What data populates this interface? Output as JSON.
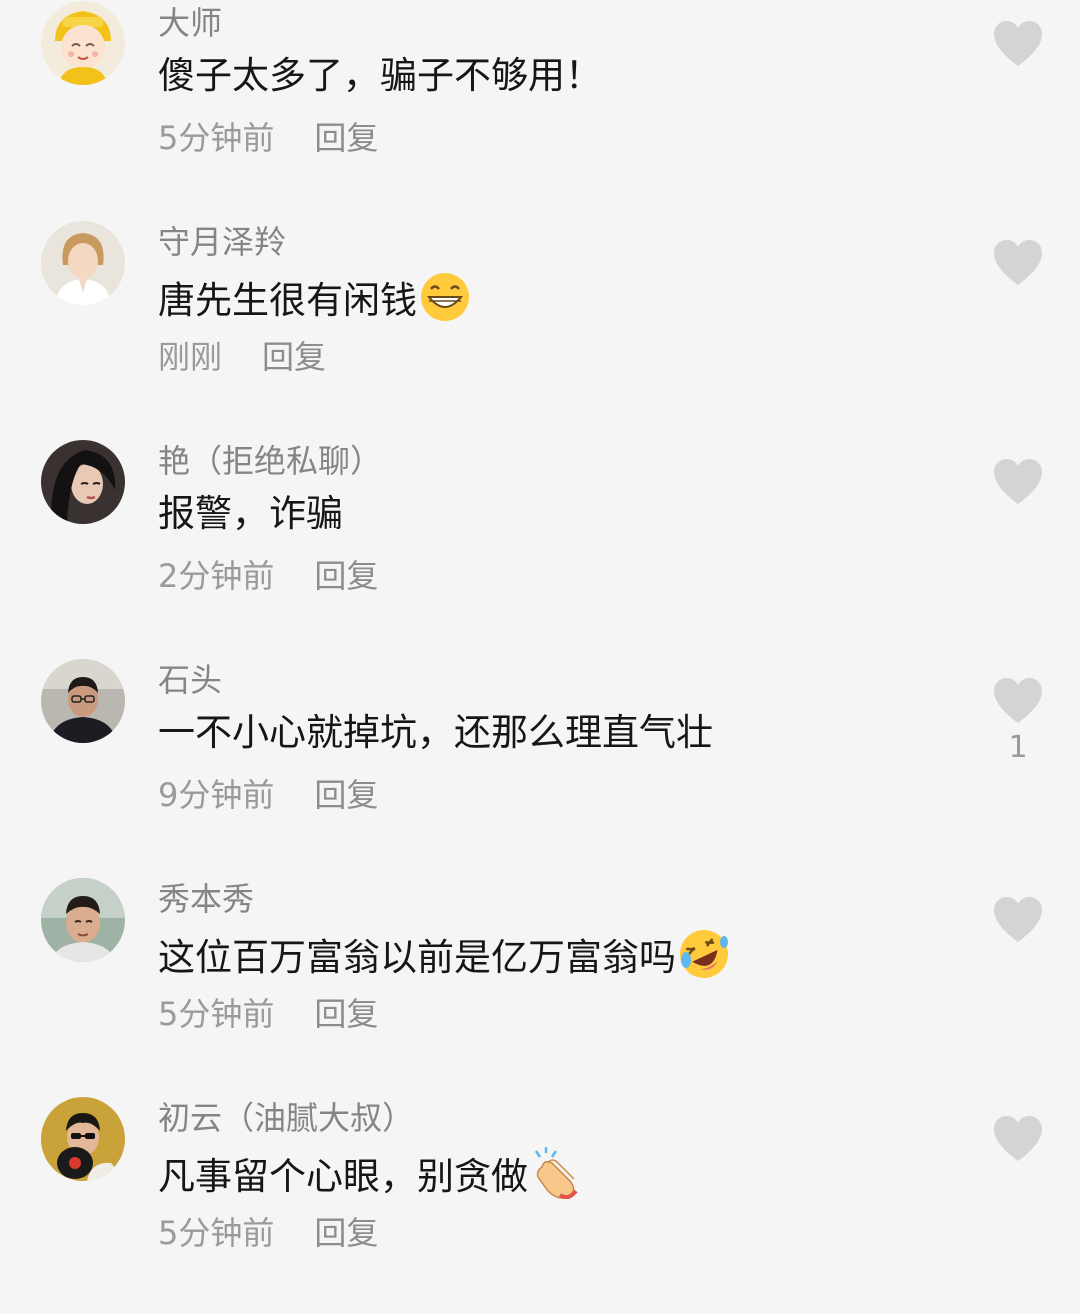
{
  "comments": [
    {
      "user": "大师",
      "text": "傻子太多了，骗子不够用！",
      "time": "5分钟前",
      "reply": "回复",
      "likes": "",
      "emoji": ""
    },
    {
      "user": "守月泽羚",
      "text": "唐先生很有闲钱",
      "time": "刚刚",
      "reply": "回复",
      "likes": "",
      "emoji": "grin-emoji"
    },
    {
      "user": "艳（拒绝私聊）",
      "text": "报警，诈骗",
      "time": "2分钟前",
      "reply": "回复",
      "likes": "",
      "emoji": ""
    },
    {
      "user": "石头",
      "text": "一不小心就掉坑，还那么理直气壮",
      "time": "9分钟前",
      "reply": "回复",
      "likes": "1",
      "emoji": ""
    },
    {
      "user": "秀本秀",
      "text": "这位百万富翁以前是亿万富翁吗",
      "time": "5分钟前",
      "reply": "回复",
      "likes": "",
      "emoji": "rofl-emoji"
    },
    {
      "user": "初云（油腻大叔）",
      "text": "凡事留个心眼，别贪做",
      "time": "5分钟前",
      "reply": "回复",
      "likes": "",
      "emoji": "clap-emoji"
    }
  ],
  "icons": {
    "like": "heart-icon"
  },
  "colors": {
    "background": "#f5f5f5",
    "text": "#161616",
    "secondary": "#9a9a9a",
    "heart": "#d4d4d4"
  }
}
